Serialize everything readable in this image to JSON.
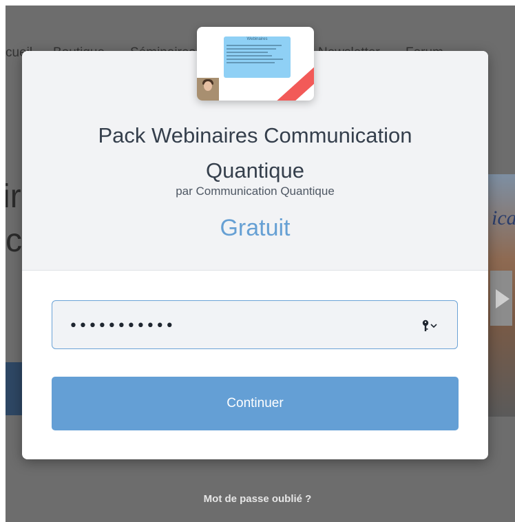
{
  "background": {
    "nav": [
      "cueil",
      "Boutique",
      "Séminaires",
      "Newsletter",
      "Forum"
    ],
    "hero_fragments": [
      "ir",
      "c"
    ],
    "video_fragment": "ica",
    "forgot_password": "Mot de passe oublié ?"
  },
  "modal": {
    "thumbnail": {
      "title": "Webinaires"
    },
    "product_title": "Pack Webinaires Communication Quantique",
    "byline": "par Communication Quantique",
    "price": "Gratuit",
    "password_value": "•••••••••••",
    "continue_label": "Continuer"
  },
  "colors": {
    "accent": "#649fd5",
    "price": "#66a0d4",
    "overlay": "#6d6d6d",
    "title": "#353f4c"
  }
}
